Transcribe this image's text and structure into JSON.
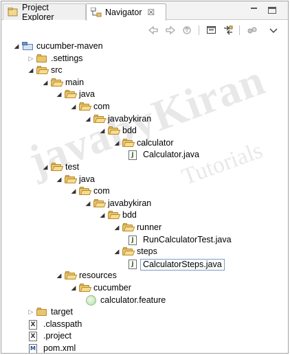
{
  "tabs": [
    {
      "label": "Project Explorer",
      "active": false
    },
    {
      "label": "Navigator",
      "active": true
    }
  ],
  "close_glyph": "☒",
  "toolbar": {
    "icons": [
      "back-icon",
      "forward-icon",
      "up-icon",
      "collapse-all-icon",
      "link-with-editor-icon",
      "options-icon",
      "view-menu-icon"
    ]
  },
  "tree": [
    {
      "label": "cucumber-maven",
      "kind": "project",
      "depth": 0,
      "expanded": true
    },
    {
      "label": ".settings",
      "kind": "folder",
      "depth": 1,
      "expanded": false
    },
    {
      "label": "src",
      "kind": "folder",
      "depth": 1,
      "expanded": true
    },
    {
      "label": "main",
      "kind": "folder",
      "depth": 2,
      "expanded": true
    },
    {
      "label": "java",
      "kind": "folder",
      "depth": 3,
      "expanded": true
    },
    {
      "label": "com",
      "kind": "folder",
      "depth": 4,
      "expanded": true
    },
    {
      "label": "javabykiran",
      "kind": "folder",
      "depth": 5,
      "expanded": true
    },
    {
      "label": "bdd",
      "kind": "folder",
      "depth": 6,
      "expanded": true
    },
    {
      "label": "calculator",
      "kind": "folder",
      "depth": 7,
      "expanded": true
    },
    {
      "label": "Calculator.java",
      "kind": "java",
      "depth": 8
    },
    {
      "label": "test",
      "kind": "folder",
      "depth": 2,
      "expanded": true
    },
    {
      "label": "java",
      "kind": "folder",
      "depth": 3,
      "expanded": true
    },
    {
      "label": "com",
      "kind": "folder",
      "depth": 4,
      "expanded": true
    },
    {
      "label": "javabykiran",
      "kind": "folder",
      "depth": 5,
      "expanded": true
    },
    {
      "label": "bdd",
      "kind": "folder",
      "depth": 6,
      "expanded": true
    },
    {
      "label": "runner",
      "kind": "folder",
      "depth": 7,
      "expanded": true
    },
    {
      "label": "RunCalculatorTest.java",
      "kind": "java",
      "depth": 8
    },
    {
      "label": "steps",
      "kind": "folder",
      "depth": 7,
      "expanded": true
    },
    {
      "label": "CalculatorSteps.java",
      "kind": "java",
      "depth": 8,
      "selected": true
    },
    {
      "label": "resources",
      "kind": "folder",
      "depth": 3,
      "expanded": true
    },
    {
      "label": "cucumber",
      "kind": "folder",
      "depth": 4,
      "expanded": true
    },
    {
      "label": "calculator.feature",
      "kind": "feature",
      "depth": 5
    },
    {
      "label": "target",
      "kind": "folder",
      "depth": 1,
      "expanded": false
    },
    {
      "label": ".classpath",
      "kind": "xml",
      "depth": 1
    },
    {
      "label": ".project",
      "kind": "xml",
      "depth": 1
    },
    {
      "label": "pom.xml",
      "kind": "pom",
      "depth": 1
    }
  ],
  "watermark": {
    "main": "javabyKiran",
    "sub": "Tutorials"
  }
}
